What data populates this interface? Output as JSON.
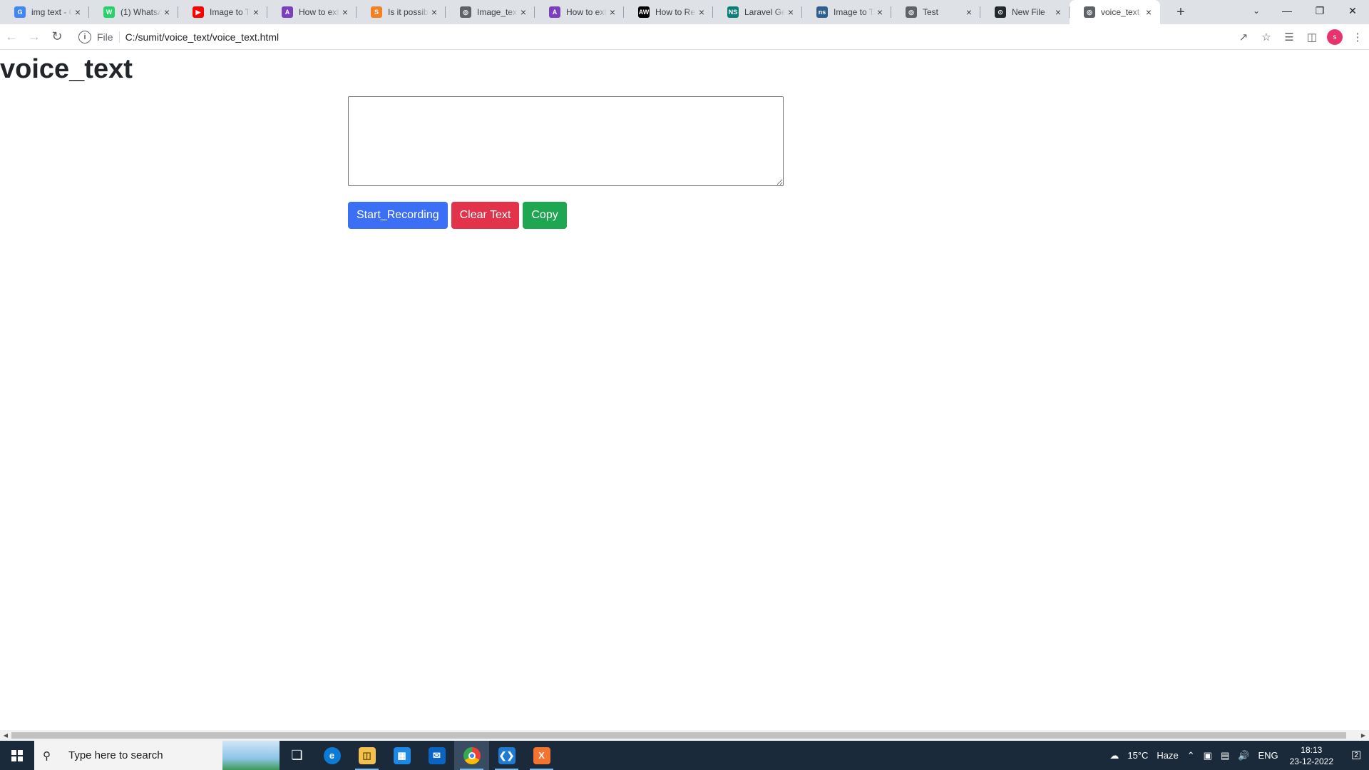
{
  "browser": {
    "tabs": [
      {
        "title": "img text - G",
        "favicon": "google-icon",
        "color": "#4285f4",
        "glyph": "G"
      },
      {
        "title": "(1) WhatsAp",
        "favicon": "whatsapp-icon",
        "color": "#25d366",
        "glyph": "W"
      },
      {
        "title": "Image to Te",
        "favicon": "youtube-icon",
        "color": "#ff0000",
        "glyph": "▶"
      },
      {
        "title": "How to extr",
        "favicon": "bookmark-icon",
        "color": "#7b3fbf",
        "glyph": "A"
      },
      {
        "title": "Is it possibl",
        "favicon": "stackoverflow-icon",
        "color": "#f48024",
        "glyph": "S"
      },
      {
        "title": "Image_text",
        "favicon": "globe-icon",
        "color": "#5f6368",
        "glyph": "◎"
      },
      {
        "title": "How to extr",
        "favicon": "bookmark-icon",
        "color": "#7b3fbf",
        "glyph": "A"
      },
      {
        "title": "How to Rea",
        "favicon": "aw-icon",
        "color": "#000000",
        "glyph": "AW"
      },
      {
        "title": "Laravel Gen",
        "favicon": "ns-icon",
        "color": "#0a7f78",
        "glyph": "NS"
      },
      {
        "title": "Image to Te",
        "favicon": "site-icon",
        "color": "#2f5f8f",
        "glyph": "ns"
      },
      {
        "title": "Test",
        "favicon": "globe-icon",
        "color": "#5f6368",
        "glyph": "◎"
      },
      {
        "title": "New File",
        "favicon": "github-icon",
        "color": "#24292e",
        "glyph": "⊙"
      },
      {
        "title": "voice_text",
        "favicon": "globe-icon",
        "color": "#5f6368",
        "glyph": "◎",
        "active": true
      }
    ],
    "new_tab_label": "+",
    "address": {
      "scheme": "File",
      "url": "C:/sumit/voice_text/voice_text.html"
    },
    "profile_initial": "s"
  },
  "page": {
    "heading": "voice_text",
    "textarea_value": "",
    "buttons": {
      "start": "Start_Recording",
      "clear": "Clear Text",
      "copy": "Copy"
    },
    "colors": {
      "start": "#3b6ff5",
      "clear": "#e3334b",
      "copy": "#1ea650"
    }
  },
  "taskbar": {
    "search_placeholder": "Type here to search",
    "weather_temp": "15°C",
    "weather_text": "Haze",
    "language": "ENG",
    "time": "18:13",
    "date": "23-12-2022",
    "notification_count": "2"
  }
}
